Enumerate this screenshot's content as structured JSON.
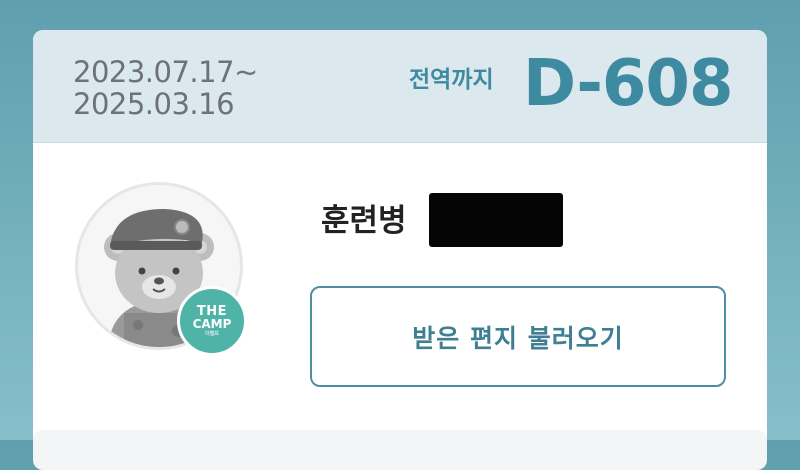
{
  "service": {
    "start_date": "2023.07.17~",
    "end_date": "2025.03.16",
    "dday_label": "전역까지",
    "dday_value": "D-608"
  },
  "profile": {
    "rank_label": "훈련병",
    "badge": {
      "line1": "THE",
      "line2": "CAMP",
      "line3": "더캠프"
    }
  },
  "actions": {
    "load_letters_label": "받은 편지 불러오기"
  },
  "colors": {
    "accent": "#3e8aa0",
    "header_bg": "#dbe8ed",
    "badge": "#4fb3a7",
    "page_bg": "#6aa8b6"
  }
}
